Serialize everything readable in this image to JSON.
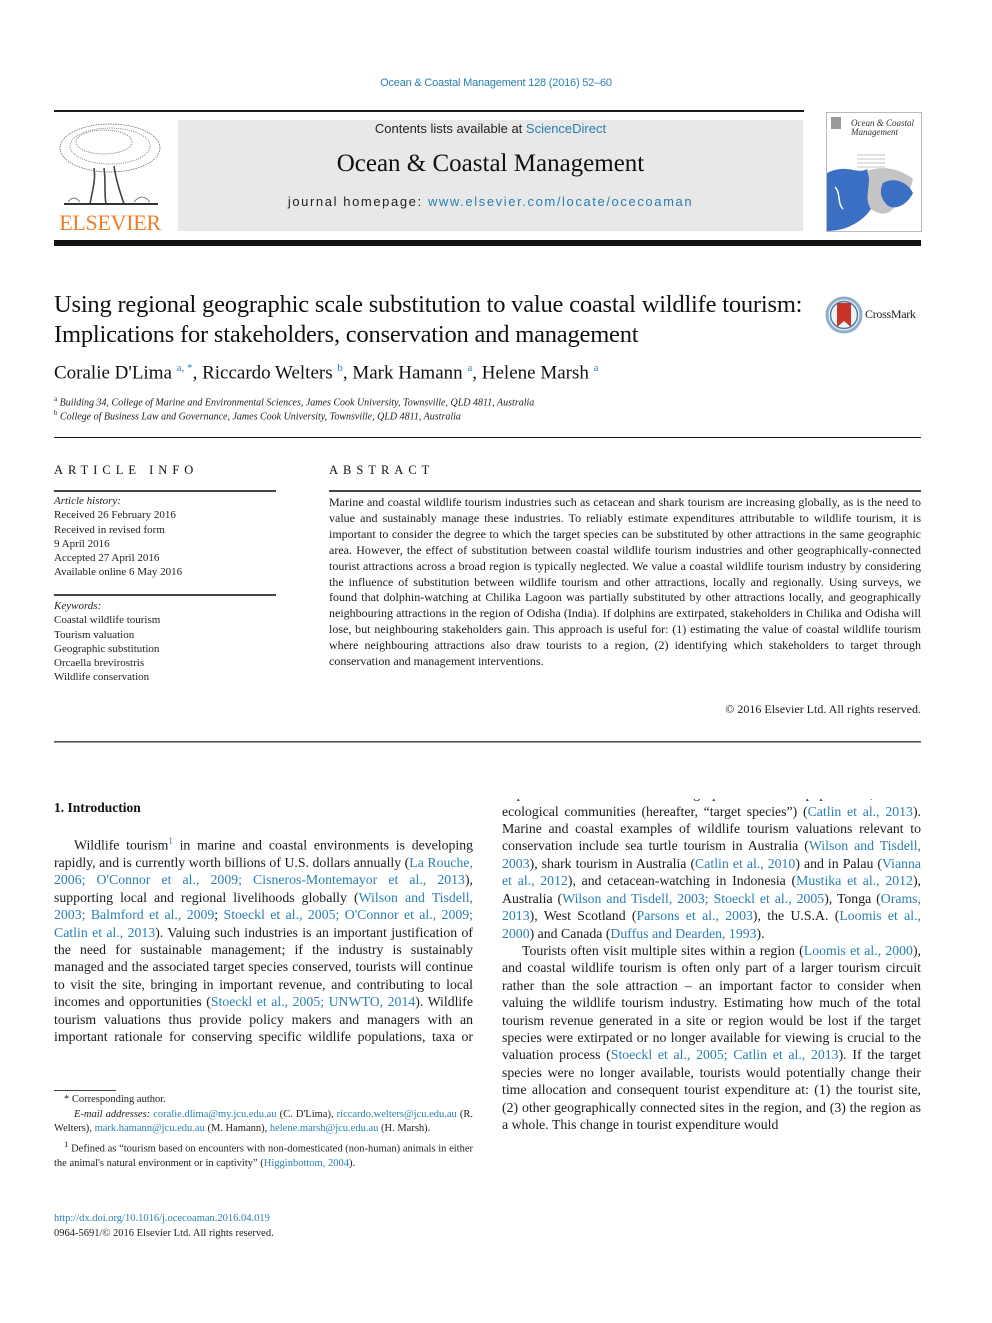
{
  "header": {
    "running_head": "Ocean & Coastal Management 128 (2016) 52–60",
    "publisher_logo_text": "ELSEVIER",
    "contents_prefix": "Contents lists available at ",
    "contents_link": "ScienceDirect",
    "journal_name": "Ocean & Coastal Management",
    "homepage_prefix": "journal homepage: ",
    "homepage_link": "www.elsevier.com/locate/ocecoaman",
    "cover_title": "Ocean & Coastal Management",
    "crossmark_label": "CrossMark"
  },
  "article": {
    "title": "Using regional geographic scale substitution to value coastal wildlife tourism: Implications for stakeholders, conservation and management",
    "authors": [
      {
        "name": "Coralie D'Lima",
        "sup": "a, *"
      },
      {
        "name": "Riccardo Welters",
        "sup": "b"
      },
      {
        "name": "Mark Hamann",
        "sup": "a"
      },
      {
        "name": "Helene Marsh",
        "sup": "a"
      }
    ],
    "affiliations": [
      {
        "key": "a",
        "text": "Building 34, College of Marine and Environmental Sciences, James Cook University, Townsville, QLD 4811, Australia"
      },
      {
        "key": "b",
        "text": "College of Business Law and Governance, James Cook University, Townsville, QLD 4811, Australia"
      }
    ]
  },
  "article_info": {
    "heading": "ARTICLE INFO",
    "history_label": "Article history:",
    "history": [
      "Received 26 February 2016",
      "Received in revised form",
      "9 April 2016",
      "Accepted 27 April 2016",
      "Available online 6 May 2016"
    ],
    "keywords_label": "Keywords:",
    "keywords": [
      "Coastal wildlife tourism",
      "Tourism valuation",
      "Geographic substitution",
      "Orcaella brevirostris",
      "Wildlife conservation"
    ]
  },
  "abstract": {
    "heading": "ABSTRACT",
    "text": "Marine and coastal wildlife tourism industries such as cetacean and shark tourism are increasing globally, as is the need to value and sustainably manage these industries. To reliably estimate expenditures attributable to wildlife tourism, it is important to consider the degree to which the target species can be substituted by other attractions in the same geographic area. However, the effect of substitution between coastal wildlife tourism industries and other geographically-connected tourist attractions across a broad region is typically neglected. We value a coastal wildlife tourism industry by considering the influence of substitution between wildlife tourism and other attractions, locally and regionally. Using surveys, we found that dolphin-watching at Chilika Lagoon was partially substituted by other attractions locally, and geographically neighbouring attractions in the region of Odisha (India). If dolphins are extirpated, stakeholders in Chilika and Odisha will lose, but neighbouring stakeholders gain. This approach is useful for: (1) estimating the value of coastal wildlife tourism where neighbouring attractions also draw tourists to a region, (2) identifying which stakeholders to target through conservation and management interventions.",
    "copyright": "© 2016 Elsevier Ltd. All rights reserved."
  },
  "body": {
    "section_heading": "1.  Introduction",
    "p1": [
      {
        "t": "Wildlife tourism"
      },
      {
        "sup": "1"
      },
      {
        "t": " in marine and coastal environments is developing rapidly, and is currently worth billions of U.S. dollars annually ("
      },
      {
        "link": "La Rouche, 2006; O'Connor et al., 2009; Cisneros-Montemayor et al., 2013"
      },
      {
        "t": "), supporting local and regional livelihoods globally ("
      },
      {
        "link": "Wilson and Tisdell, 2003; Balmford et al., 2009"
      },
      {
        "t": "; "
      },
      {
        "link": "Stoeckl et al., 2005; O'Connor et al., 2009; Catlin et al., 2013"
      },
      {
        "t": "). Valuing such industries is an important justification of the need for sustainable management; if the industry is sustainably managed and the associated target species conserved, tourists will continue to visit the site, bringing in important revenue, and contributing to local incomes and opportunities ("
      },
      {
        "link": "Stoeckl et al., 2005; UNWTO, 2014"
      },
      {
        "t": "). Wildlife tourism valuations thus provide policy makers and managers with an important rationale for conserving specific wildlife populations, taxa or ecological communities (hereafter, “target species”) ("
      },
      {
        "link": "Catlin et al., 2013"
      },
      {
        "t": "). Marine and coastal examples of wildlife tourism valuations relevant to conservation include sea turtle tourism in Australia ("
      },
      {
        "link": "Wilson and Tisdell, 2003"
      },
      {
        "t": "), shark tourism in Australia ("
      },
      {
        "link": "Catlin et al., 2010"
      },
      {
        "t": ") and in Palau ("
      },
      {
        "link": "Vianna et al., 2012"
      },
      {
        "t": "), and cetacean-watching in Indonesia ("
      },
      {
        "link": "Mustika et al., 2012"
      },
      {
        "t": "), Australia ("
      },
      {
        "link": "Wilson and Tisdell, 2003; Stoeckl et al., 2005"
      },
      {
        "t": "), Tonga ("
      },
      {
        "link": "Orams, 2013"
      },
      {
        "t": "), West Scotland ("
      },
      {
        "link": "Parsons et al., 2003"
      },
      {
        "t": "), the U.S.A. ("
      },
      {
        "link": "Loomis et al., 2000"
      },
      {
        "t": ") and Canada ("
      },
      {
        "link": "Duffus and Dearden, 1993"
      },
      {
        "t": ")."
      }
    ],
    "p2": [
      {
        "t": "Tourists often visit multiple sites within a region ("
      },
      {
        "link": "Loomis et al., 2000"
      },
      {
        "t": "), and coastal wildlife tourism is often only part of a larger tourism circuit rather than the sole attraction – an important factor to consider when valuing the wildlife tourism industry. Estimating how much of the total tourism revenue generated in a site or region would be lost if the target species were extirpated or no longer available for viewing is crucial to the valuation process ("
      },
      {
        "link": "Stoeckl et al., 2005; Catlin et al., 2013"
      },
      {
        "t": "). If the target species were no longer available, tourists would potentially change their time allocation and consequent tourist expenditure at: (1) the tourist site, (2) other geographically connected sites in the region, and (3) the region as a whole. This change in tourist expenditure would"
      }
    ]
  },
  "footnotes": {
    "corresponding": "* Corresponding author.",
    "email_label": "E-mail addresses:",
    "emails": [
      {
        "addr": "coralie.dlima@my.jcu.edu.au",
        "who": "(C. D'Lima)"
      },
      {
        "addr": "riccardo.welters@jcu.edu.au",
        "who": "(R. Welters)"
      },
      {
        "addr": "mark.hamann@jcu.edu.au",
        "who": "(M. Hamann)"
      },
      {
        "addr": "helene.marsh@jcu.edu.au",
        "who": "(H. Marsh)."
      }
    ],
    "fn1_mark": "1",
    "fn1_text": "Defined as “tourism based on encounters with non-domesticated (non-human) animals in either the animal's natural environment or in captivity” (",
    "fn1_link": "Higginbottom, 2004",
    "fn1_end": ").",
    "doi": "http://dx.doi.org/10.1016/j.ocecoaman.2016.04.019",
    "issn": "0964-5691/© 2016 Elsevier Ltd. All rights reserved."
  }
}
